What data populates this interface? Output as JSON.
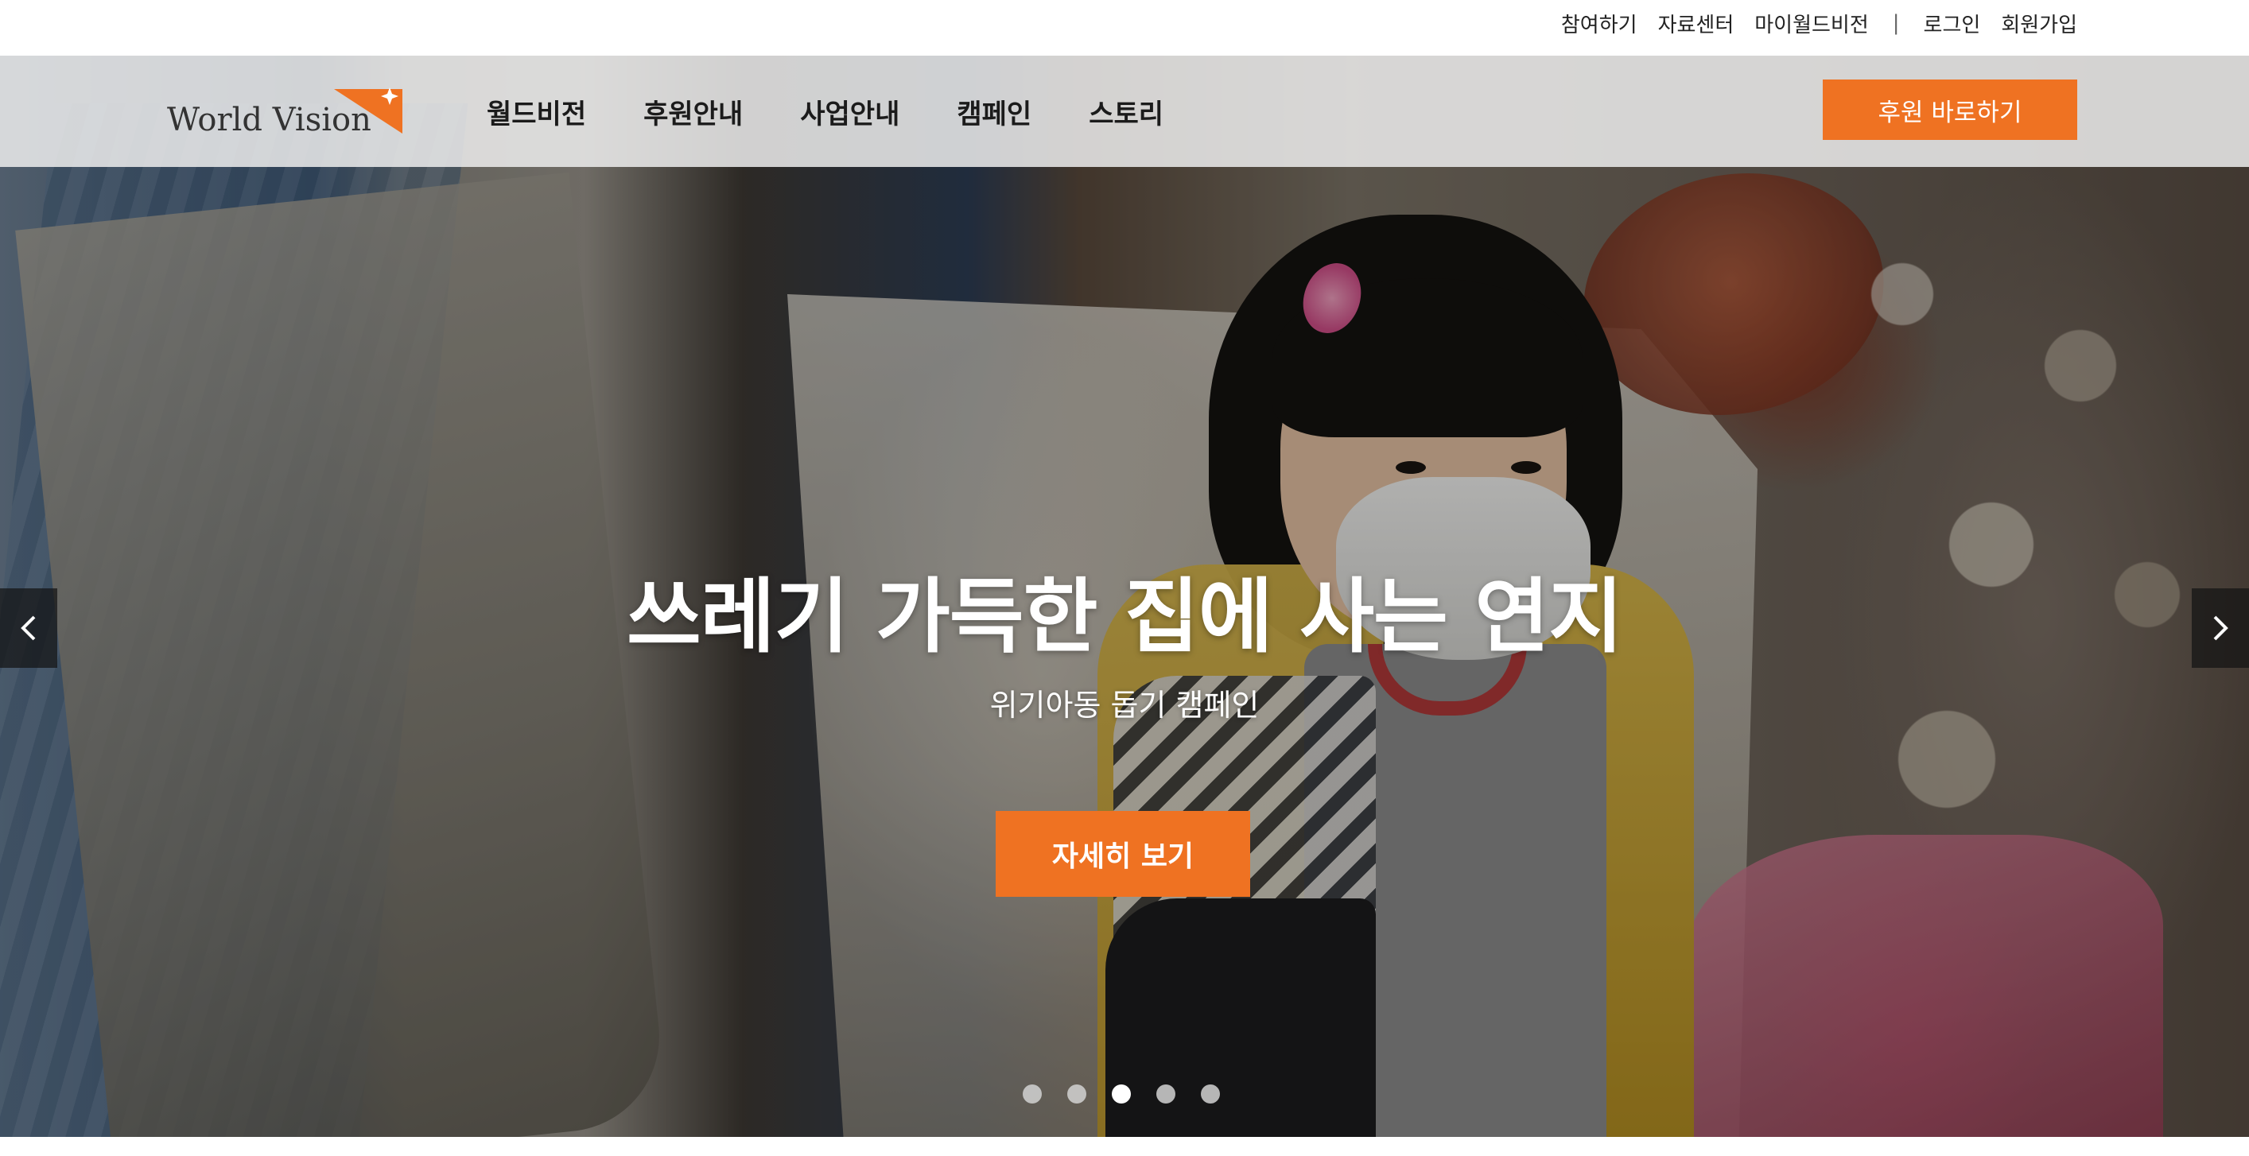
{
  "utility_nav": {
    "items": [
      "참여하기",
      "자료센터",
      "마이월드비전",
      "로그인",
      "회원가입"
    ],
    "separator": "|"
  },
  "logo": {
    "text": "World Vision",
    "accent_color": "#ef7222"
  },
  "main_nav": {
    "items": [
      "월드비전",
      "후원안내",
      "사업안내",
      "캠페인",
      "스토리"
    ]
  },
  "header_cta": {
    "label": "후원 바로하기",
    "color": "#ef7222"
  },
  "hero": {
    "title": "쓰레기 가득한 집에 사는 연지",
    "subtitle": "위기아동 돕기 캠페인",
    "cta_label": "자세히 보기",
    "cta_color": "#ef7222",
    "prev_icon": "chevron-left-icon",
    "next_icon": "chevron-right-icon"
  },
  "carousel": {
    "total_slides": 5,
    "active_slide": 3
  }
}
